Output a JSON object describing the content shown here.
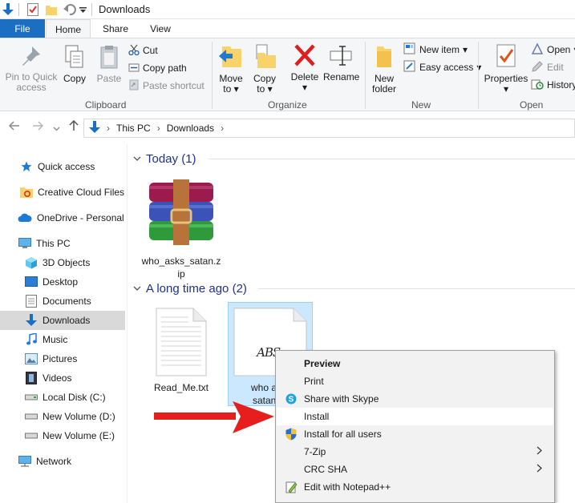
{
  "window": {
    "title": "Downloads"
  },
  "tabs": {
    "file": "File",
    "home": "Home",
    "share": "Share",
    "view": "View"
  },
  "ribbon": {
    "clipboard": {
      "label": "Clipboard",
      "pin_line1": "Pin to Quick",
      "pin_line2": "access",
      "copy": "Copy",
      "paste": "Paste",
      "cut": "Cut",
      "copy_path": "Copy path",
      "paste_shortcut": "Paste shortcut"
    },
    "organize": {
      "label": "Organize",
      "move_to_line1": "Move",
      "move_to_line2": "to",
      "copy_to_line1": "Copy",
      "copy_to_line2": "to",
      "delete": "Delete",
      "rename": "Rename"
    },
    "new": {
      "label": "New",
      "new_folder_line1": "New",
      "new_folder_line2": "folder",
      "new_item": "New item",
      "easy_access": "Easy access"
    },
    "open": {
      "label": "Open",
      "properties": "Properties",
      "open": "Open",
      "edit": "Edit",
      "history": "History"
    }
  },
  "address": {
    "crumbs": [
      "This PC",
      "Downloads"
    ]
  },
  "nav": {
    "items": [
      {
        "label": "Quick access",
        "icon": "star-icon"
      },
      {
        "label": "Creative Cloud Files",
        "icon": "creative-cloud-folder-icon"
      },
      {
        "label": "OneDrive - Personal",
        "icon": "onedrive-cloud-icon"
      },
      {
        "label": "This PC",
        "icon": "computer-icon"
      },
      {
        "label": "3D Objects",
        "icon": "3d-objects-icon"
      },
      {
        "label": "Desktop",
        "icon": "desktop-icon"
      },
      {
        "label": "Documents",
        "icon": "documents-icon"
      },
      {
        "label": "Downloads",
        "icon": "downloads-arrow-icon"
      },
      {
        "label": "Music",
        "icon": "music-note-icon"
      },
      {
        "label": "Pictures",
        "icon": "pictures-icon"
      },
      {
        "label": "Videos",
        "icon": "videos-film-icon"
      },
      {
        "label": "Local Disk (C:)",
        "icon": "drive-icon"
      },
      {
        "label": "New Volume (D:)",
        "icon": "drive-icon"
      },
      {
        "label": "New Volume (E:)",
        "icon": "drive-icon"
      },
      {
        "label": "Network",
        "icon": "network-icon"
      }
    ]
  },
  "content": {
    "groups": [
      {
        "header": "Today (1)"
      },
      {
        "header": "A long time ago (2)"
      }
    ],
    "files": {
      "zip_line1": "who_asks_satan.z",
      "zip_line2": "ip",
      "readme": "Read_Me.txt",
      "font_line1": "who a",
      "font_line2": "satan",
      "font_preview_text": "ABS"
    }
  },
  "context_menu": {
    "items": [
      {
        "label": "Preview",
        "bold": true
      },
      {
        "label": "Print"
      },
      {
        "label": "Share with Skype",
        "icon": "skype-icon"
      },
      {
        "label": "Install",
        "highlighted": true
      },
      {
        "label": "Install for all users",
        "icon": "uac-shield-icon"
      },
      {
        "label": "7-Zip",
        "submenu": true
      },
      {
        "label": "CRC SHA",
        "submenu": true
      },
      {
        "label": "Edit with Notepad++",
        "icon": "notepad-plus-plus-icon"
      }
    ]
  },
  "colors": {
    "accent": "#1a6fc2",
    "selection": "#cce8ff",
    "arrow": "#e61e1e",
    "group_header": "#1e3287"
  }
}
